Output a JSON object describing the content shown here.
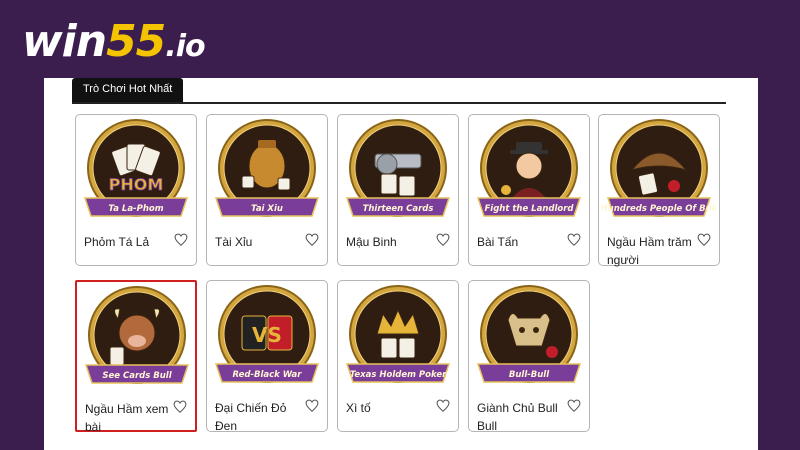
{
  "brand": {
    "logo_main": "win",
    "logo_number": "55",
    "logo_tld": ".io"
  },
  "colors": {
    "background": "#3b1d4e",
    "accent": "#f5c400",
    "banner": "#7a3d9a",
    "selected_border": "#d11f1f"
  },
  "section": {
    "tab_label": "Trò Chơi Hot Nhất"
  },
  "games": [
    {
      "name": "Phỏm Tá Lả",
      "thumb_label": "Ta La-Phom",
      "icon": "cards-phom-icon",
      "selected": false
    },
    {
      "name": "Tài Xỉu",
      "thumb_label": "Tai Xiu",
      "icon": "dice-cup-icon",
      "selected": false
    },
    {
      "name": "Mậu Binh",
      "thumb_label": "Thirteen Cards",
      "icon": "revolver-cards-icon",
      "selected": false
    },
    {
      "name": "Bài Tấn",
      "thumb_label": "Fight the Landlord",
      "icon": "landlord-icon",
      "selected": false
    },
    {
      "name": "Ngầu Hầm trăm người",
      "thumb_label": "Hundreds People Of Bull",
      "icon": "bull-hat-icon",
      "selected": false
    },
    {
      "name": "Ngầu Hầm xem bài",
      "thumb_label": "See Cards Bull",
      "icon": "cartoon-bull-icon",
      "selected": true
    },
    {
      "name": "Đại Chiến Đỏ Đen",
      "thumb_label": "Red-Black War",
      "icon": "versus-icon",
      "selected": false
    },
    {
      "name": "Xì tố",
      "thumb_label": "Texas Holdem Poker",
      "icon": "crown-cards-icon",
      "selected": false
    },
    {
      "name": "Giành Chủ Bull Bull",
      "thumb_label": "Bull-Bull",
      "icon": "bull-skull-icon",
      "selected": false
    }
  ]
}
